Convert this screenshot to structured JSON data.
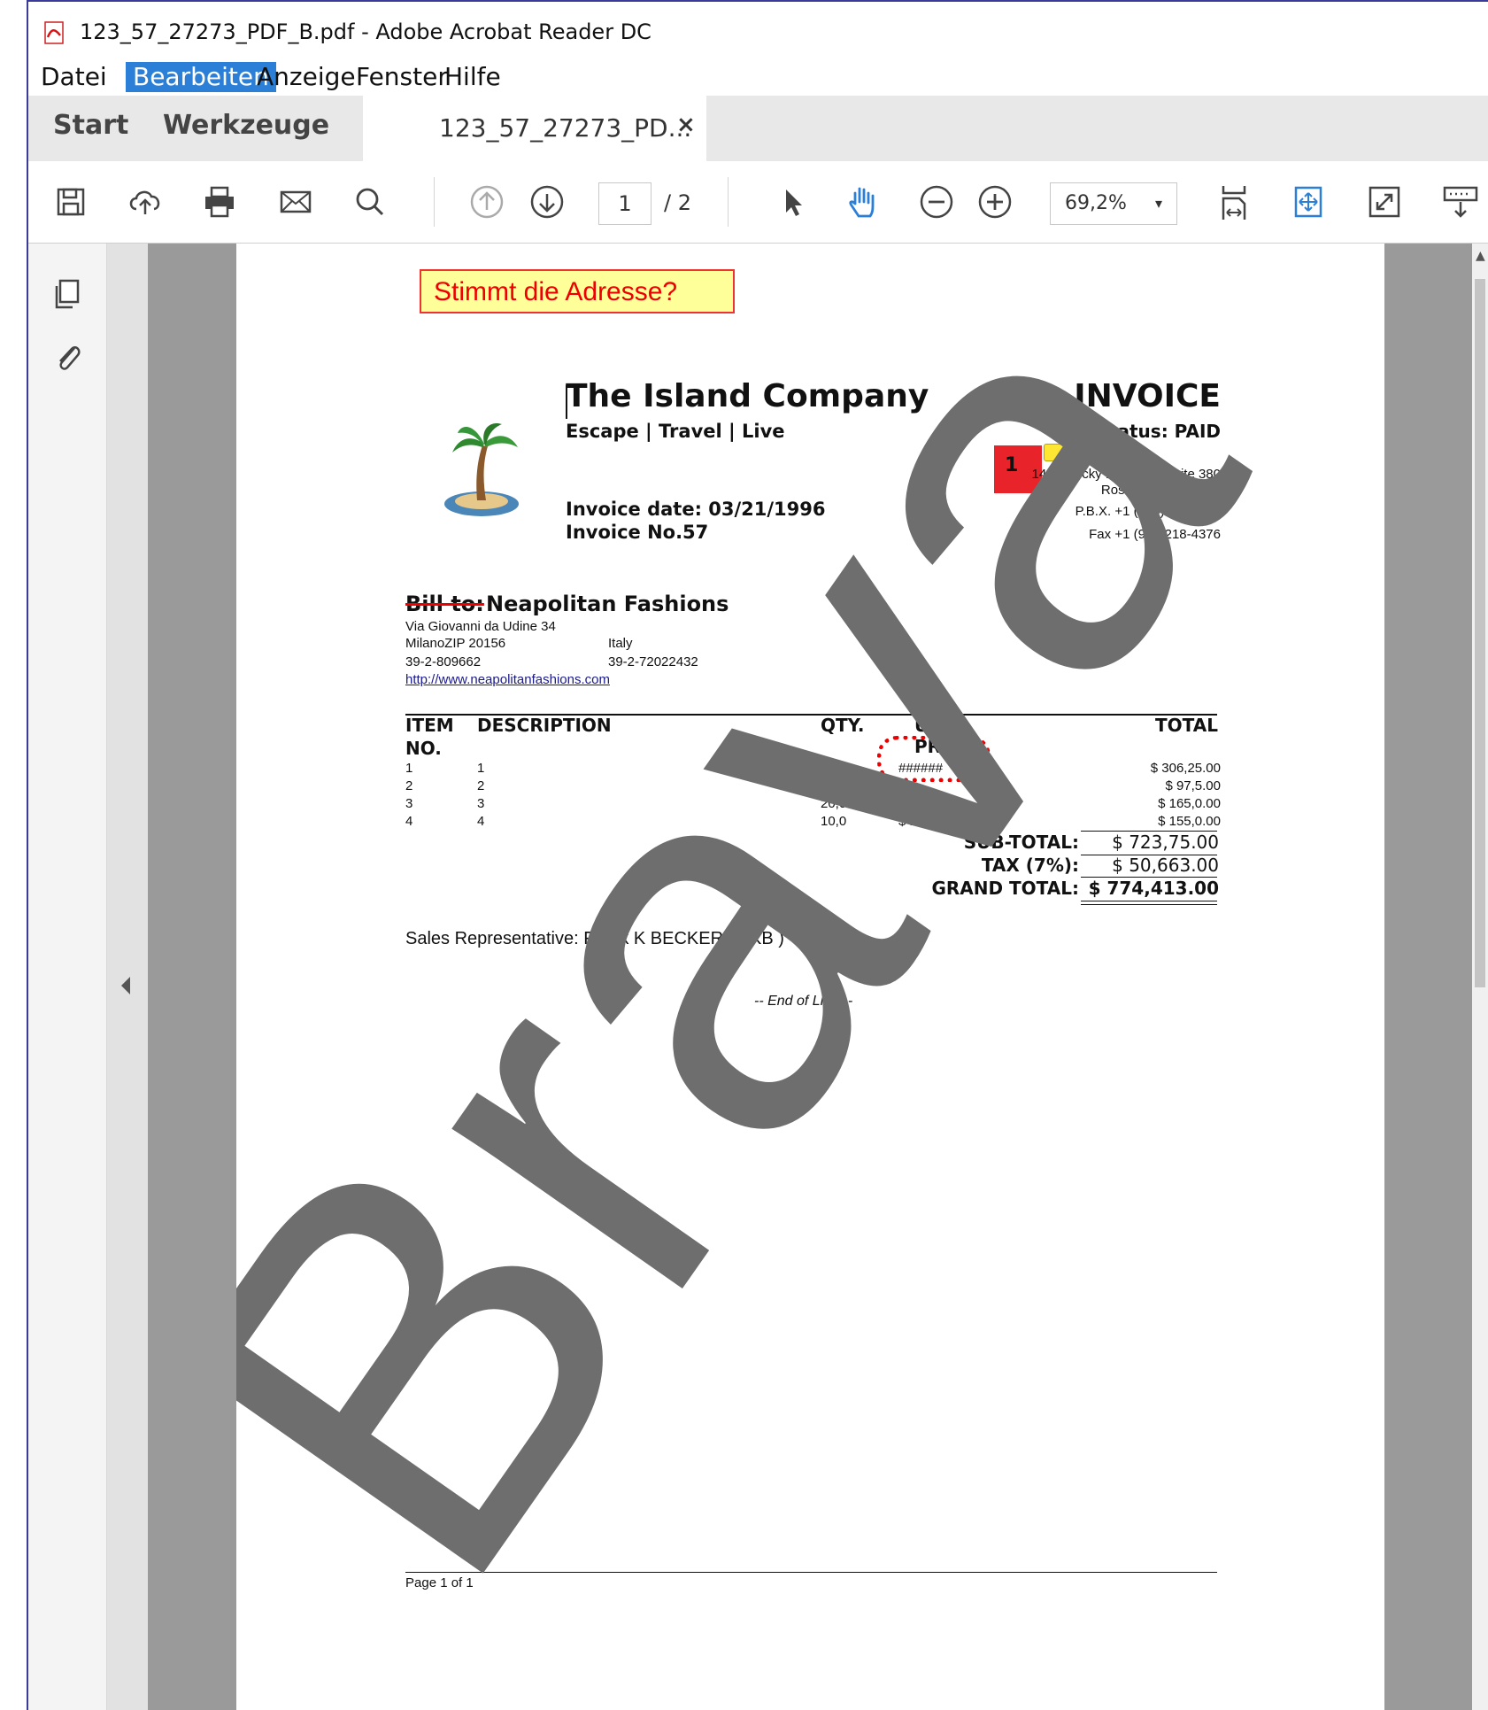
{
  "window": {
    "title": "123_57_27273_PDF_B.pdf - Adobe Acrobat Reader DC"
  },
  "menu": {
    "items": [
      "Datei",
      "Bearbeiten",
      "Anzeige",
      "Fenster",
      "Hilfe"
    ]
  },
  "tabs": {
    "start": "Start",
    "tools": "Werkzeuge",
    "document": "123_57_27273_PD...",
    "close": "×"
  },
  "toolbar": {
    "page_current": "1",
    "page_total": "/ 2",
    "zoom": "69,2%",
    "zoom_arrow": "▾",
    "icons": [
      "save-icon",
      "upload-icon",
      "print-icon",
      "email-icon",
      "search-icon",
      "prev-page-icon",
      "next-page-icon",
      "select-cursor-icon",
      "hand-tool-icon",
      "zoom-out-icon",
      "zoom-in-icon",
      "fit-page-icon",
      "fit-width-icon",
      "fullscreen-icon",
      "read-mode-icon"
    ]
  },
  "document": {
    "sticky_note": "Stimmt die Adresse?",
    "company": "The Island Company",
    "tagline": "Escape | Travel | Live",
    "invoice_title": "INVOICE",
    "status": "Status: PAID",
    "address": [
      "1420 Rocky Ridge Dr. Suite 380",
      "Roseville, CA 95661",
      "P.B.X. +1 (916)218-4700",
      "Fax +1 (916)218-4376"
    ],
    "comment_number": "1",
    "invoice_date": "Invoice date: 03/21/1996",
    "invoice_no": "Invoice No.57",
    "bill_to_label": "Bill to:",
    "bill_to_name": "Neapolitan Fashions",
    "bill_address": "Via Giovanni da Udine 34",
    "bill_city": "MilanoZIP 20156",
    "bill_country": "Italy",
    "bill_phone": "39-2-809662",
    "bill_fax": "39-2-72022432",
    "bill_url": "http://www.neapolitanfashions.com",
    "table": {
      "headers": {
        "item": "ITEM",
        "item2": "NO.",
        "desc": "DESCRIPTION",
        "qty": "QTY.",
        "unit": "UNIT",
        "unit2": "PRICE",
        "total": "TOTAL"
      },
      "rows": [
        {
          "no": "1",
          "desc": "1",
          "qty": "25,0",
          "price": "######",
          "total": "$ 306,25.00"
        },
        {
          "no": "2",
          "desc": "2",
          "qty": "15,0",
          "price": "",
          "total": "$ 97,5.00"
        },
        {
          "no": "3",
          "desc": "3",
          "qty": "20,0",
          "price": "$ 8,25.00",
          "total": "$ 165,0.00"
        },
        {
          "no": "4",
          "desc": "4",
          "qty": "10,0",
          "price": "$ 15,5.00",
          "total": "$ 155,0.00"
        }
      ]
    },
    "subtotal_label": "SUB-TOTAL:",
    "subtotal": "$ 723,75.00",
    "tax_label": "TAX (7%):",
    "tax": "$ 50,663.00",
    "grand_label": "GRAND TOTAL:",
    "grand": "$ 774,413.00",
    "sales_rep": "Sales Representative: Frank K BECKER ( FKB )",
    "end_of_line": "-- End of Line --",
    "page_footer": "Page 1 of 1",
    "watermark": "Brava"
  },
  "colors": {
    "accent": "#2b7fd6",
    "annotation_red": "#e00000",
    "sticky_bg": "#ffff99",
    "watermark": "#6e6e6e"
  }
}
